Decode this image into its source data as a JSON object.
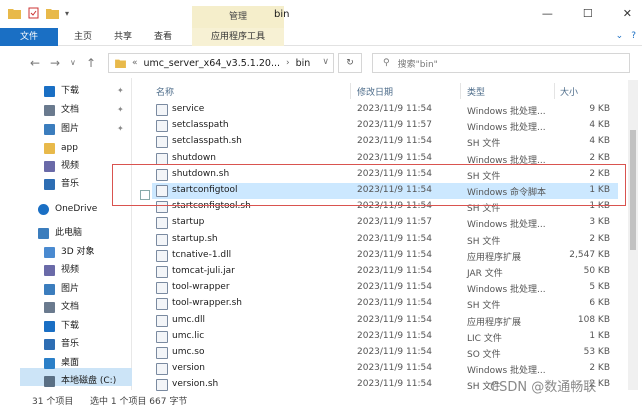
{
  "window": {
    "title": "bin",
    "context_tab": "管理",
    "controls": [
      "—",
      "☐",
      "✕"
    ]
  },
  "ribbon": {
    "file": "文件",
    "home": "主页",
    "share": "共享",
    "view": "查看",
    "app_tools": "应用程序工具"
  },
  "address": {
    "crumb1": "umc_server_x64_v3.5.1.20...",
    "crumb2": "bin",
    "search_placeholder": "搜索\"bin\""
  },
  "nav_pane": {
    "items": [
      {
        "label": "下载",
        "icon": "download-icon",
        "pinned": true
      },
      {
        "label": "文档",
        "icon": "document-icon",
        "pinned": true
      },
      {
        "label": "图片",
        "icon": "picture-icon",
        "pinned": true
      },
      {
        "label": "app",
        "icon": "folder-icon",
        "pinned": false
      },
      {
        "label": "视频",
        "icon": "video-icon",
        "pinned": false
      },
      {
        "label": "音乐",
        "icon": "music-icon",
        "pinned": false
      },
      {
        "label": "OneDrive",
        "icon": "cloud-icon",
        "pinned": false
      },
      {
        "label": "此电脑",
        "icon": "computer-icon",
        "pinned": false
      },
      {
        "label": "3D 对象",
        "icon": "cube-icon",
        "pinned": false
      },
      {
        "label": "视频",
        "icon": "video-icon",
        "pinned": false
      },
      {
        "label": "图片",
        "icon": "picture-icon",
        "pinned": false
      },
      {
        "label": "文档",
        "icon": "document-icon",
        "pinned": false
      },
      {
        "label": "下载",
        "icon": "download-icon",
        "pinned": false
      },
      {
        "label": "音乐",
        "icon": "music-icon",
        "pinned": false
      },
      {
        "label": "桌面",
        "icon": "desktop-icon",
        "pinned": false
      },
      {
        "label": "本地磁盘 (C:)",
        "icon": "drive-icon",
        "pinned": false
      }
    ]
  },
  "columns": {
    "name": "名称",
    "date": "修改日期",
    "type": "类型",
    "size": "大小"
  },
  "files": [
    {
      "name": "service",
      "date": "2023/11/9 11:54",
      "type": "Windows 批处理...",
      "size": "9 KB"
    },
    {
      "name": "setclasspath",
      "date": "2023/11/9 11:57",
      "type": "Windows 批处理...",
      "size": "4 KB"
    },
    {
      "name": "setclasspath.sh",
      "date": "2023/11/9 11:54",
      "type": "SH 文件",
      "size": "4 KB"
    },
    {
      "name": "shutdown",
      "date": "2023/11/9 11:54",
      "type": "Windows 批处理...",
      "size": "2 KB"
    },
    {
      "name": "shutdown.sh",
      "date": "2023/11/9 11:54",
      "type": "SH 文件",
      "size": "2 KB"
    },
    {
      "name": "startconfigtool",
      "date": "2023/11/9 11:54",
      "type": "Windows 命令脚本",
      "size": "1 KB"
    },
    {
      "name": "startconfigtool.sh",
      "date": "2023/11/9 11:54",
      "type": "SH 文件",
      "size": "1 KB"
    },
    {
      "name": "startup",
      "date": "2023/11/9 11:57",
      "type": "Windows 批处理...",
      "size": "3 KB"
    },
    {
      "name": "startup.sh",
      "date": "2023/11/9 11:54",
      "type": "SH 文件",
      "size": "2 KB"
    },
    {
      "name": "tcnative-1.dll",
      "date": "2023/11/9 11:54",
      "type": "应用程序扩展",
      "size": "2,547 KB"
    },
    {
      "name": "tomcat-juli.jar",
      "date": "2023/11/9 11:54",
      "type": "JAR 文件",
      "size": "50 KB"
    },
    {
      "name": "tool-wrapper",
      "date": "2023/11/9 11:54",
      "type": "Windows 批处理...",
      "size": "5 KB"
    },
    {
      "name": "tool-wrapper.sh",
      "date": "2023/11/9 11:54",
      "type": "SH 文件",
      "size": "6 KB"
    },
    {
      "name": "umc.dll",
      "date": "2023/11/9 11:54",
      "type": "应用程序扩展",
      "size": "108 KB"
    },
    {
      "name": "umc.lic",
      "date": "2023/11/9 11:54",
      "type": "LIC 文件",
      "size": "1 KB"
    },
    {
      "name": "umc.so",
      "date": "2023/11/9 11:54",
      "type": "SO 文件",
      "size": "53 KB"
    },
    {
      "name": "version",
      "date": "2023/11/9 11:54",
      "type": "Windows 批处理...",
      "size": "2 KB"
    },
    {
      "name": "version.sh",
      "date": "2023/11/9 11:54",
      "type": "SH 文件",
      "size": "2 KB"
    }
  ],
  "status": {
    "count": "31 个项目",
    "selected": "选中 1 个项目  667 字节"
  },
  "watermark": "CSDN @数通畅联",
  "colors": {
    "accent": "#1a6fc4",
    "selection": "#cce8ff",
    "highlight": "#d9534f"
  }
}
